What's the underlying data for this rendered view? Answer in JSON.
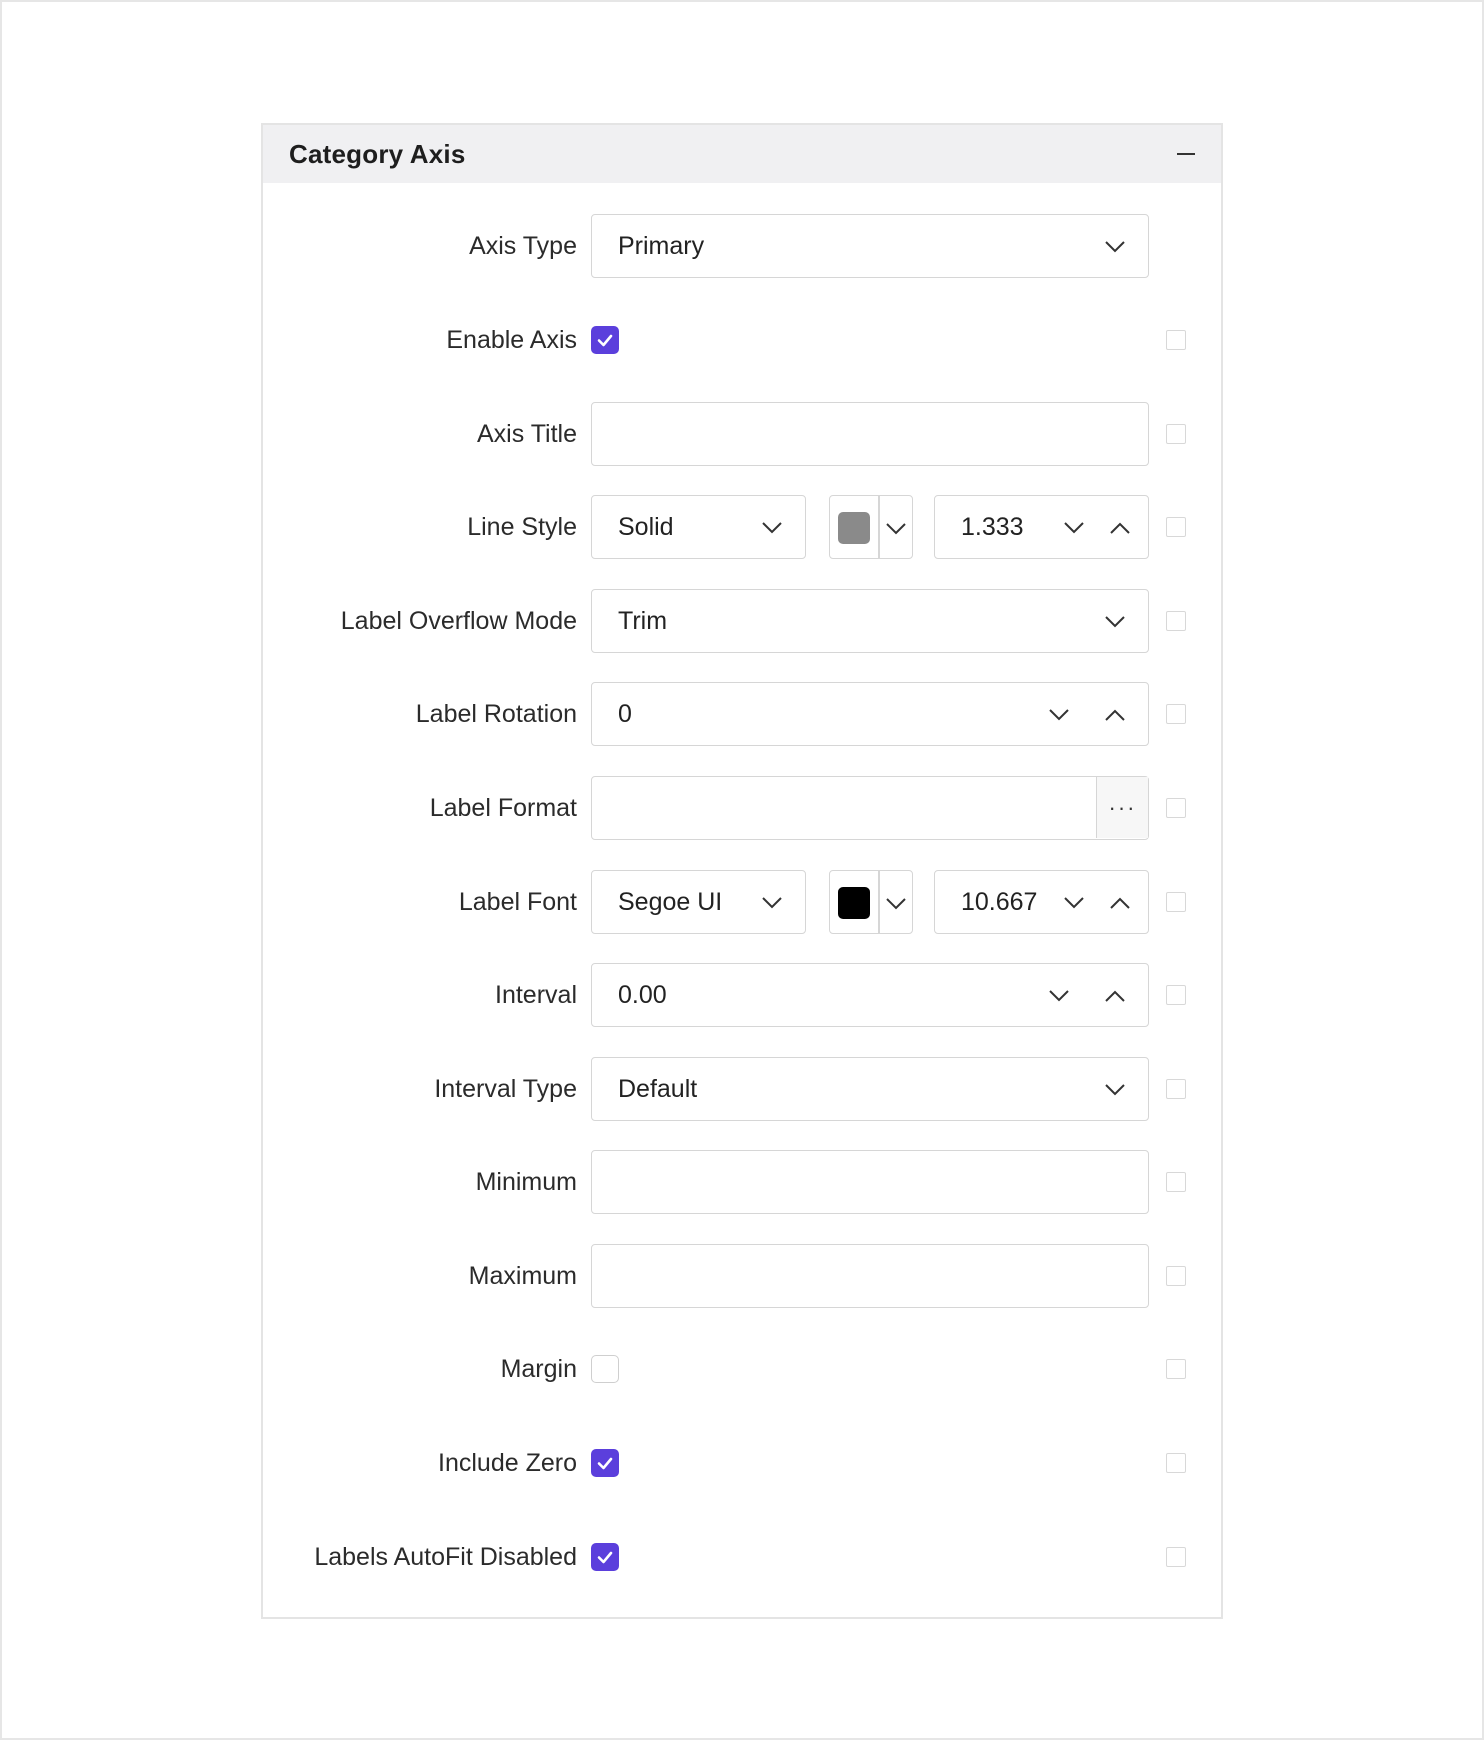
{
  "panel": {
    "title": "Category Axis"
  },
  "rows": {
    "axis_type": {
      "label": "Axis Type",
      "value": "Primary"
    },
    "enable_axis": {
      "label": "Enable Axis",
      "checked": true
    },
    "axis_title": {
      "label": "Axis Title",
      "value": ""
    },
    "line_style": {
      "label": "Line Style",
      "style": "Solid",
      "color": "#8a8a8a",
      "width": "1.333"
    },
    "label_overflow_mode": {
      "label": "Label Overflow Mode",
      "value": "Trim"
    },
    "label_rotation": {
      "label": "Label Rotation",
      "value": "0"
    },
    "label_format": {
      "label": "Label Format",
      "value": "",
      "button": "···"
    },
    "label_font": {
      "label": "Label Font",
      "family": "Segoe UI",
      "color": "#000000",
      "size": "10.667"
    },
    "interval": {
      "label": "Interval",
      "value": "0.00"
    },
    "interval_type": {
      "label": "Interval Type",
      "value": "Default"
    },
    "minimum": {
      "label": "Minimum",
      "value": ""
    },
    "maximum": {
      "label": "Maximum",
      "value": ""
    },
    "margin": {
      "label": "Margin",
      "checked": false
    },
    "include_zero": {
      "label": "Include Zero",
      "checked": true
    },
    "labels_autofit_disabled": {
      "label": "Labels AutoFit Disabled",
      "checked": true
    }
  },
  "colors": {
    "accent": "#5b3fdc",
    "header_bg": "#f0f0f2",
    "border": "#d6d6d6"
  }
}
